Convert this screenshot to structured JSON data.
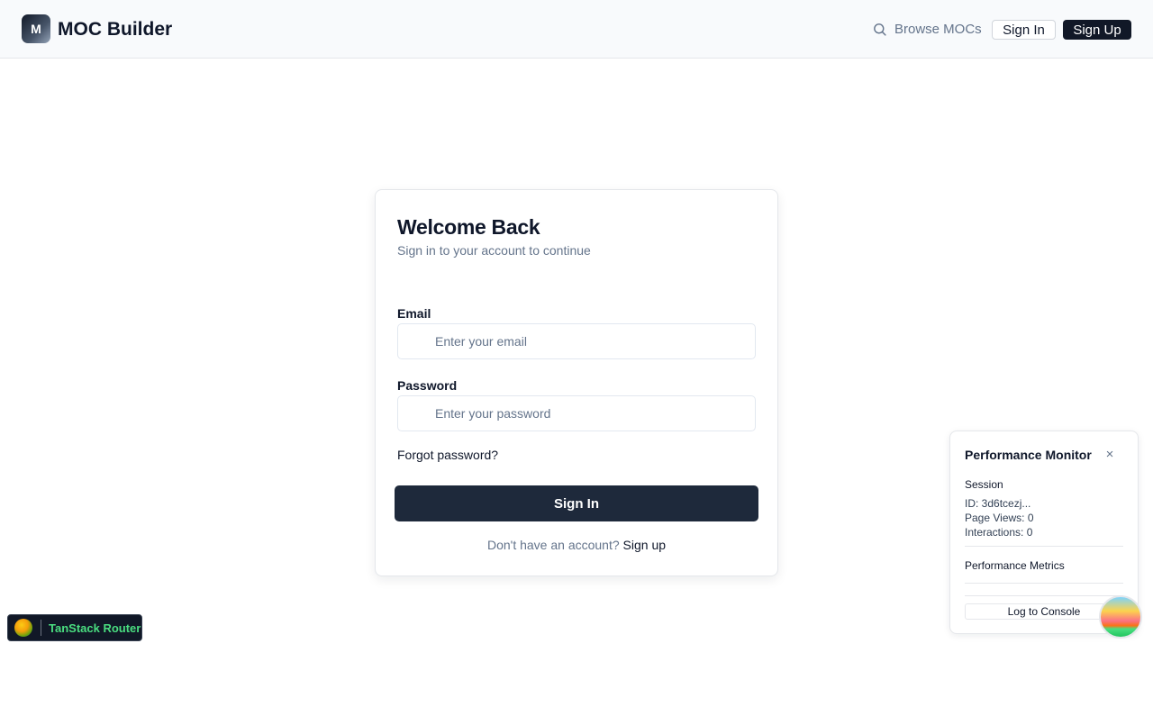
{
  "header": {
    "logo_letter": "M",
    "brand": "MOC Builder",
    "browse_label": "Browse MOCs",
    "sign_in_label": "Sign In",
    "sign_up_label": "Sign Up"
  },
  "login": {
    "title": "Welcome Back",
    "subtitle": "Sign in to your account to continue",
    "email_label": "Email",
    "email_placeholder": "Enter your email",
    "email_value": "",
    "password_label": "Password",
    "password_placeholder": "Enter your password",
    "password_value": "",
    "forgot_label": "Forgot password?",
    "submit_label": "Sign In",
    "no_account_text": "Don't have an account?",
    "sign_up_link": "Sign up"
  },
  "devtools": {
    "label": "TanStack Router"
  },
  "perf_monitor": {
    "title": "Performance Monitor",
    "close": "×",
    "session_heading": "Session",
    "session_id": "ID: 3d6tcezj...",
    "page_views": "Page Views: 0",
    "interactions": "Interactions: 0",
    "metrics_heading": "Performance Metrics",
    "log_button": "Log to Console"
  },
  "colors": {
    "primary": "#1e293b",
    "muted": "#64748b",
    "devtools_accent": "#4ade80"
  },
  "icons": [
    "search-icon",
    "close-icon"
  ]
}
